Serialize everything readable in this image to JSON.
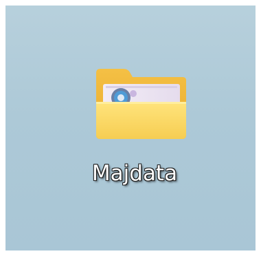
{
  "desktop": {
    "shortcut": {
      "label": "Majdata",
      "icon": "folder-icon"
    }
  }
}
